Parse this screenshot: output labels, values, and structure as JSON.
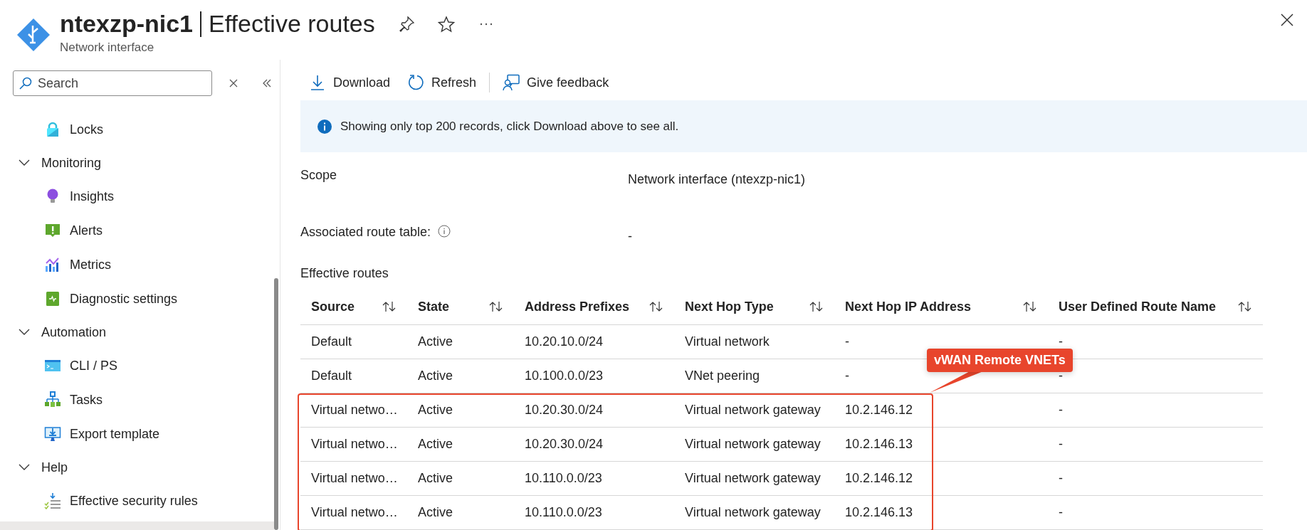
{
  "header": {
    "title": "ntexzp-nic1",
    "page": "Effective routes",
    "subtitle": "Network interface"
  },
  "sidebar": {
    "search": {
      "placeholder": "Search"
    },
    "items": [
      {
        "kind": "item",
        "label": "Locks"
      },
      {
        "kind": "group",
        "label": "Monitoring",
        "expanded": true,
        "children": [
          {
            "label": "Insights"
          },
          {
            "label": "Alerts"
          },
          {
            "label": "Metrics"
          },
          {
            "label": "Diagnostic settings"
          }
        ]
      },
      {
        "kind": "group",
        "label": "Automation",
        "expanded": true,
        "children": [
          {
            "label": "CLI / PS"
          },
          {
            "label": "Tasks"
          },
          {
            "label": "Export template"
          }
        ]
      },
      {
        "kind": "group",
        "label": "Help",
        "expanded": true,
        "children": [
          {
            "label": "Effective security rules"
          }
        ]
      }
    ]
  },
  "toolbar": [
    {
      "kind": "download",
      "label": "Download"
    },
    {
      "kind": "refresh",
      "label": "Refresh"
    },
    {
      "kind": "feedback",
      "label": "Give feedback"
    }
  ],
  "banner": {
    "text": "Showing only top 200 records, click Download above to see all."
  },
  "fields": [
    {
      "label": "Scope",
      "value": "Network interface (ntexzp-nic1)",
      "info": false
    },
    {
      "label": "Associated route table:",
      "value": "-",
      "info": true
    }
  ],
  "table": {
    "title": "Effective routes",
    "columns": [
      "Source",
      "State",
      "Address Prefixes",
      "Next Hop Type",
      "Next Hop IP Address",
      "User Defined Route Name"
    ],
    "rows": [
      {
        "cells": [
          "Default",
          "Active",
          "10.20.10.0/24",
          "Virtual network",
          "-",
          "-"
        ],
        "highlighted": false
      },
      {
        "cells": [
          "Default",
          "Active",
          "10.100.0.0/23",
          "VNet peering",
          "-",
          "-"
        ],
        "highlighted": false
      },
      {
        "cells": [
          "Virtual netwo…",
          "Active",
          "10.20.30.0/24",
          "Virtual network gateway",
          "10.2.146.12",
          "-"
        ],
        "highlighted": true
      },
      {
        "cells": [
          "Virtual netwo…",
          "Active",
          "10.20.30.0/24",
          "Virtual network gateway",
          "10.2.146.13",
          "-"
        ],
        "highlighted": true
      },
      {
        "cells": [
          "Virtual netwo…",
          "Active",
          "10.110.0.0/23",
          "Virtual network gateway",
          "10.2.146.12",
          "-"
        ],
        "highlighted": true
      },
      {
        "cells": [
          "Virtual netwo…",
          "Active",
          "10.110.0.0/23",
          "Virtual network gateway",
          "10.2.146.13",
          "-"
        ],
        "highlighted": true
      }
    ],
    "callout": {
      "label": "vWAN Remote VNETs"
    }
  }
}
